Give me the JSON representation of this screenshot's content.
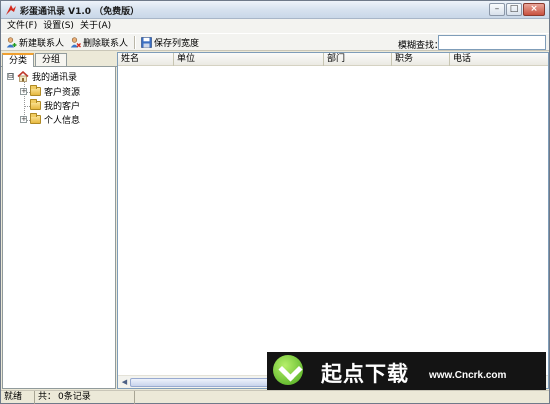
{
  "window": {
    "title": "彩蛋通讯录 V1.0 （免费版）",
    "controls": {
      "minimize": "–",
      "maximize": "□",
      "close": "×"
    }
  },
  "menu": [
    "文件(F)",
    "设置(S)",
    "关于(A)"
  ],
  "toolbar": {
    "new_contact": "新建联系人",
    "delete_contact": "删除联系人",
    "save_column_width": "保存列宽度",
    "search_label": "模糊查找：",
    "search_value": ""
  },
  "sidebar": {
    "tabs": [
      {
        "label": "分类",
        "active": true
      },
      {
        "label": "分组",
        "active": false
      }
    ],
    "tree": {
      "root": {
        "label": "我的通讯录",
        "expander": "⊟",
        "icon": "house-icon"
      },
      "children": [
        {
          "label": "客户资源",
          "expander": "+",
          "icon": "folder-icon"
        },
        {
          "label": "我的客户",
          "expander": "",
          "icon": "folder-icon"
        },
        {
          "label": "个人信息",
          "expander": "+",
          "icon": "folder-icon"
        }
      ]
    }
  },
  "grid": {
    "columns": [
      "姓名",
      "单位",
      "部门",
      "职务",
      "电话"
    ],
    "rows": [],
    "scroll": {
      "left_arrow": "◀",
      "right_arrow": "▶"
    }
  },
  "status": {
    "ready": "就绪",
    "total_label": "共：",
    "record_count": "0条记录"
  },
  "watermark": {
    "text": "起点下载",
    "url": "www.Cncrk.com"
  },
  "colors": {
    "accent_tab": "#f0a030",
    "window_bg": "#ece9d8",
    "banner_bg": "#141414",
    "logo_green": "#49a81b"
  }
}
